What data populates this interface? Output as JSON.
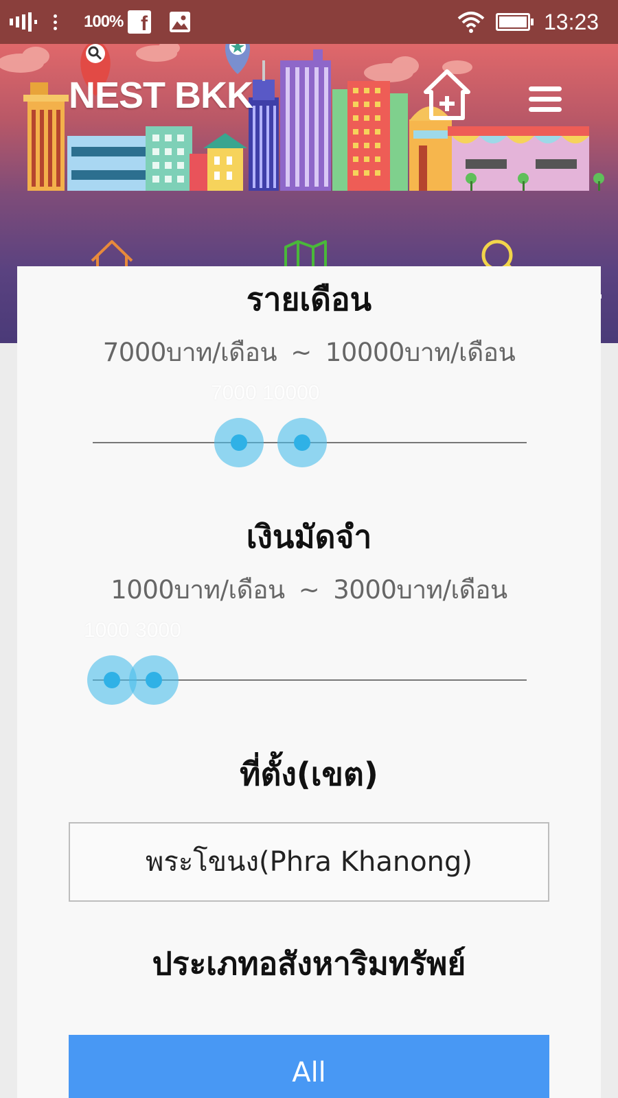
{
  "status_bar": {
    "battery": "100%",
    "time": "13:23",
    "icons": [
      "signal-icon",
      "overflow-dots-icon",
      "facebook-icon",
      "gallery-icon",
      "wifi-icon",
      "battery-icon"
    ]
  },
  "header": {
    "brand": "NEST BKK",
    "colors": {
      "banner_top": "#e0686a",
      "banner_bottom": "#4a3a78"
    },
    "actions": [
      "add-listing-icon",
      "menu-icon"
    ],
    "tabs": [
      {
        "icon": "home-icon",
        "color": "#e88a3b",
        "active": false
      },
      {
        "icon": "map-icon",
        "color": "#4ab83a",
        "active": false
      },
      {
        "icon": "search-icon",
        "color": "#f2d54a",
        "active": true
      }
    ]
  },
  "filters": {
    "rent": {
      "title": "รายเดือน",
      "min_label": "7000บาท/เดือน",
      "separator": "~",
      "max_label": "10000บาท/เดือน",
      "slider_value_text": "7000 10000"
    },
    "deposit": {
      "title": "เงินมัดจำ",
      "min_label": "1000บาท/เดือน",
      "separator": "~",
      "max_label": "3000บาท/เดือน",
      "slider_value_text": "1000 3000"
    },
    "location": {
      "title": "ที่ตั้ง(เขต)",
      "selected": "พระโขนง(Phra Khanong)"
    },
    "property_type": {
      "title": "ประเภทอสังหาริมทรัพย์",
      "button_label": "All",
      "button_color": "#4898f4"
    }
  }
}
